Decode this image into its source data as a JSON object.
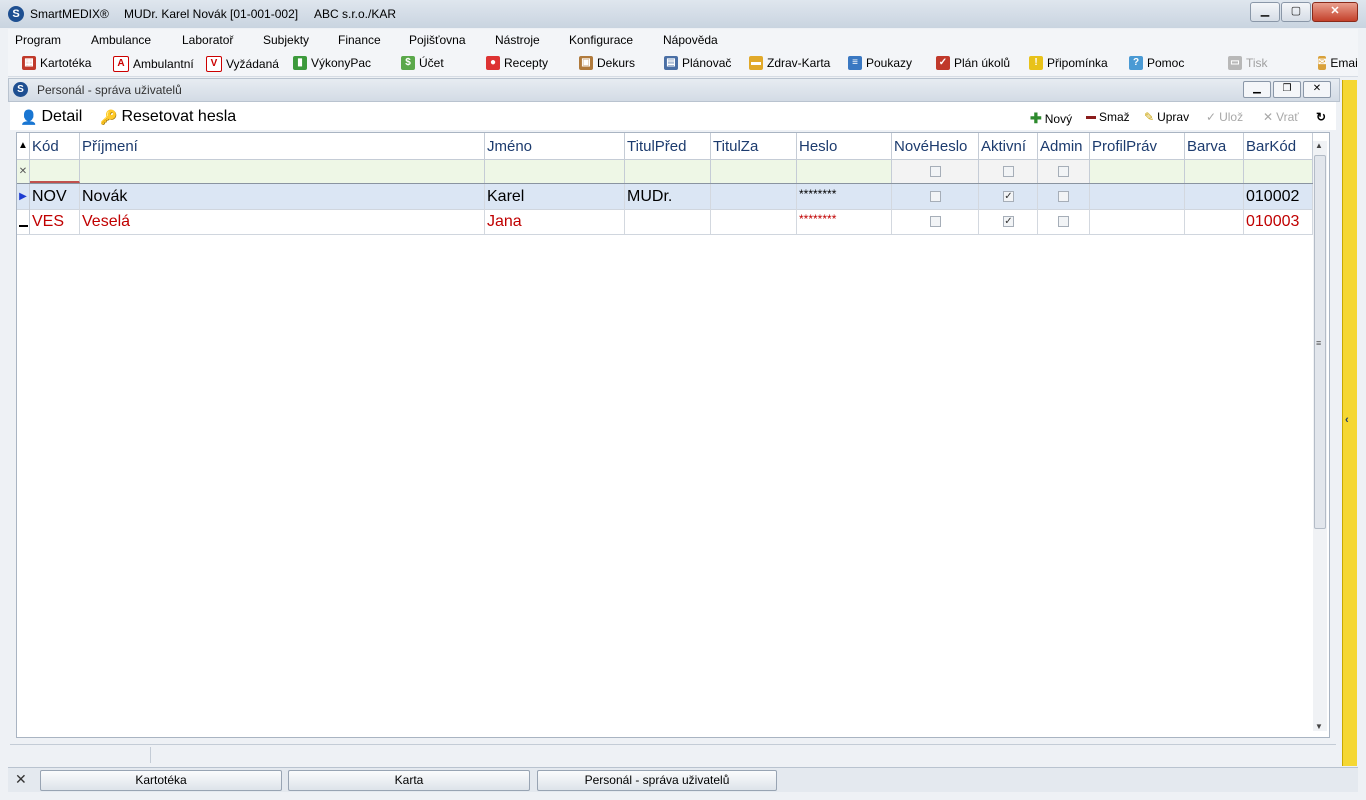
{
  "window": {
    "app": "SmartMEDIX®",
    "user": "MUDr. Karel Novák [01-001-002]",
    "org": "ABC s.r.o./KAR"
  },
  "menu": [
    "Program",
    "Ambulance",
    "Laboratoř",
    "Subjekty",
    "Finance",
    "Pojišťovna",
    "Nástroje",
    "Konfigurace",
    "Nápověda"
  ],
  "toolbar": [
    "Kartotéka",
    "Ambulantní",
    "Vyžádaná",
    "VýkonyPac",
    "Účet",
    "Recepty",
    "Dekurs",
    "Plánovač",
    "Zdrav-Karta",
    "Poukazy",
    "Plán úkolů",
    "Připomínka",
    "Pomoc",
    "Tisk",
    "Email"
  ],
  "child_title": "Personál - správa uživatelů",
  "actions": {
    "detail": "Detail",
    "reset": "Resetovat hesla",
    "new": "Nový",
    "delete": "Smaž",
    "edit": "Uprav",
    "save": "Ulož",
    "revert": "Vrať"
  },
  "columns": [
    "Kód",
    "Příjmení",
    "Jméno",
    "TitulPřed",
    "TitulZa",
    "Heslo",
    "NovéHeslo",
    "Aktivní",
    "Admin",
    "ProfilPráv",
    "Barva",
    "BarKód"
  ],
  "rows": [
    {
      "kod": "NOV",
      "prijmeni": "Novák",
      "jmeno": "Karel",
      "titul_pred": "MUDr.",
      "titul_za": "",
      "heslo": "********",
      "nove_heslo": false,
      "aktivni": true,
      "admin": false,
      "profil": "",
      "barva": "",
      "barkod": "010002",
      "color": "#000000"
    },
    {
      "kod": "VES",
      "prijmeni": "Veselá",
      "jmeno": "Jana",
      "titul_pred": "",
      "titul_za": "",
      "heslo": "********",
      "nove_heslo": false,
      "aktivni": true,
      "admin": false,
      "profil": "",
      "barva": "",
      "barkod": "010003",
      "color": "#c00000"
    }
  ],
  "tasks": [
    "Kartotéka",
    "Karta",
    "Personál - správa uživatelů"
  ]
}
